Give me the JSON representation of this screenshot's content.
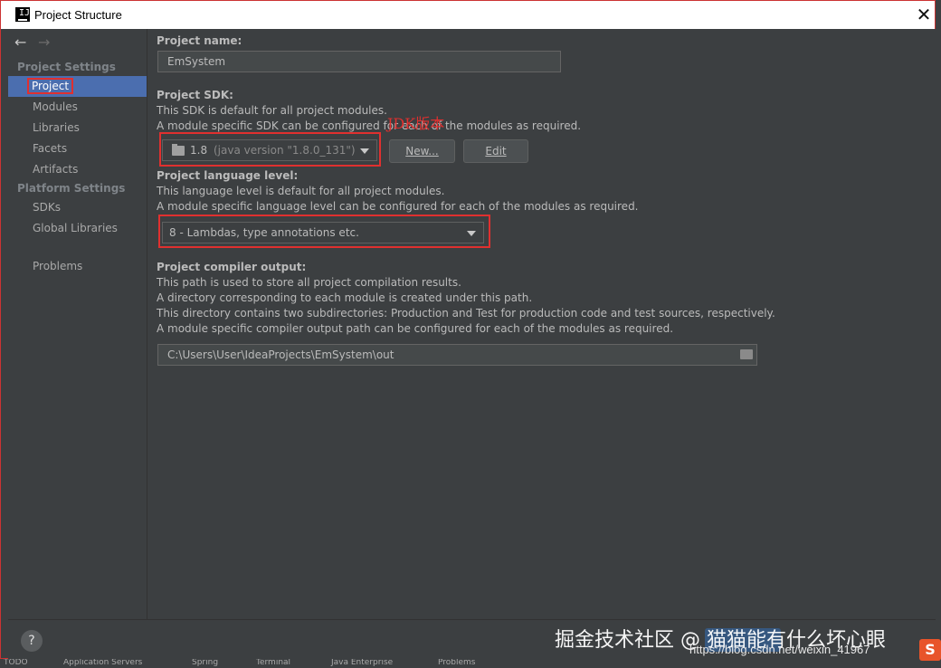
{
  "window": {
    "title": "Project Structure"
  },
  "sidebar": {
    "project_settings_label": "Project Settings",
    "project_settings_items": [
      "Project",
      "Modules",
      "Libraries",
      "Facets",
      "Artifacts"
    ],
    "platform_settings_label": "Platform Settings",
    "platform_settings_items": [
      "SDKs",
      "Global Libraries"
    ],
    "problems_label": "Problems",
    "selected": "Project"
  },
  "main": {
    "project_name_label": "Project name:",
    "project_name_value": "EmSystem",
    "sdk_label": "Project SDK:",
    "sdk_desc_1": "This SDK is default for all project modules.",
    "sdk_desc_2": "A module specific SDK can be configured for each of the modules as required.",
    "sdk_value_version": "1.8",
    "sdk_value_detail": "(java version \"1.8.0_131\")",
    "new_button": "New...",
    "edit_button": "Edit",
    "annotation": "JDK版本",
    "language_level_label": "Project language level:",
    "language_desc_1": "This language level is default for all project modules.",
    "language_desc_2": "A module specific language level can be configured for each of the modules as required.",
    "language_level_value": "8 - Lambdas, type annotations etc.",
    "compiler_output_label": "Project compiler output:",
    "compiler_desc_1": "This path is used to store all project compilation results.",
    "compiler_desc_2": "A directory corresponding to each module is created under this path.",
    "compiler_desc_3": "This directory contains two subdirectories: Production and Test for production code and test sources, respectively.",
    "compiler_desc_4": "A module specific compiler output path can be configured for each of the modules as required.",
    "compiler_output_value": "C:\\Users\\User\\IdeaProjects\\EmSystem\\out"
  },
  "footer": {
    "help": "?"
  },
  "background_tabs": [
    "TODO",
    "Application Servers",
    "Spring",
    "Terminal",
    "Java Enterprise",
    "Problems"
  ],
  "watermark": {
    "text": "掘金技术社区 @ 猫猫能有什么坏心眼",
    "url": "https://blog.csdn.net/weixin_41967"
  },
  "colors": {
    "selection": "#4b6eaf",
    "highlight": "#e0302f",
    "background": "#3c3f41"
  }
}
